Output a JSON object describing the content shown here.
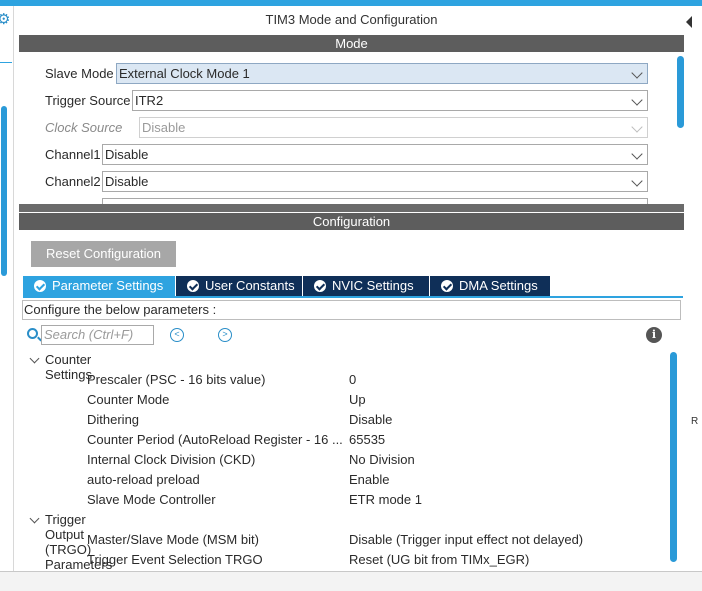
{
  "window": {
    "title": "TIM3 Mode and Configuration"
  },
  "mode_section": {
    "header": "Mode",
    "fields": [
      {
        "label": "Slave Mode",
        "value": "External Clock Mode 1",
        "disabled": false
      },
      {
        "label": "Trigger Source",
        "value": "ITR2",
        "disabled": false
      },
      {
        "label": "Clock Source",
        "value": "Disable",
        "disabled": true
      },
      {
        "label": "Channel1",
        "value": "Disable",
        "disabled": false
      },
      {
        "label": "Channel2",
        "value": "Disable",
        "disabled": false
      }
    ]
  },
  "config_section": {
    "header": "Configuration",
    "reset_label": "Reset Configuration",
    "tabs": [
      {
        "label": "Parameter Settings",
        "active": true
      },
      {
        "label": "User Constants",
        "active": false
      },
      {
        "label": "NVIC Settings",
        "active": false
      },
      {
        "label": "DMA Settings",
        "active": false
      }
    ],
    "configure_text": "Configure the below parameters :",
    "search_placeholder": "Search (Ctrl+F)",
    "groups": [
      {
        "label": "Counter Settings",
        "params": [
          {
            "name": "Prescaler (PSC - 16 bits value)",
            "value": "0"
          },
          {
            "name": "Counter Mode",
            "value": "Up"
          },
          {
            "name": "Dithering",
            "value": "Disable"
          },
          {
            "name": "Counter Period (AutoReload Register - 16 ...",
            "value": "65535"
          },
          {
            "name": "Internal Clock Division (CKD)",
            "value": "No Division"
          },
          {
            "name": "auto-reload preload",
            "value": "Enable"
          },
          {
            "name": "Slave Mode Controller",
            "value": "ETR mode 1"
          }
        ]
      },
      {
        "label": "Trigger Output (TRGO) Parameters",
        "params": [
          {
            "name": "Master/Slave Mode (MSM bit)",
            "value": "Disable (Trigger input effect not delayed)"
          },
          {
            "name": "Trigger Event Selection TRGO",
            "value": "Reset (UG bit from TIMx_EGR)"
          }
        ]
      }
    ]
  },
  "side_text": "R",
  "colors": {
    "accent": "#2ea3e0",
    "tab_dark": "#0f2f58",
    "section_bar": "#5d5d5d",
    "button": "#a7a7a7"
  }
}
